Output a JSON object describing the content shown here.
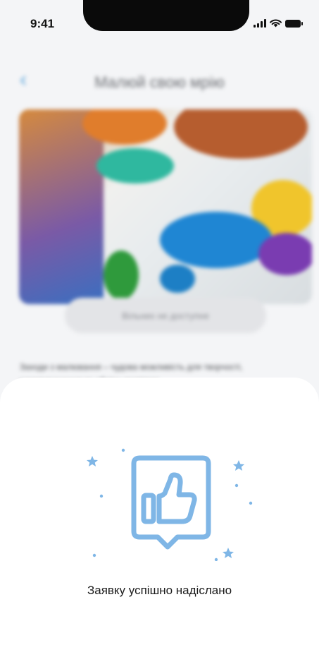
{
  "status_bar": {
    "time": "9:41"
  },
  "background_page": {
    "back_icon": "chevron-left-icon",
    "title": "Малюй свою мрію",
    "status_button_label": "Вільних не доступне",
    "description": "Заходи з малювання – чудова можливість для творчості, самовираження та обміну досвідом"
  },
  "success_sheet": {
    "icon": "thumbs-up-icon",
    "message": "Заявку успішно надіслано"
  },
  "colors": {
    "accent": "#7fb6e6",
    "sheet_background": "#ffffff",
    "page_background": "#f4f5f7"
  }
}
